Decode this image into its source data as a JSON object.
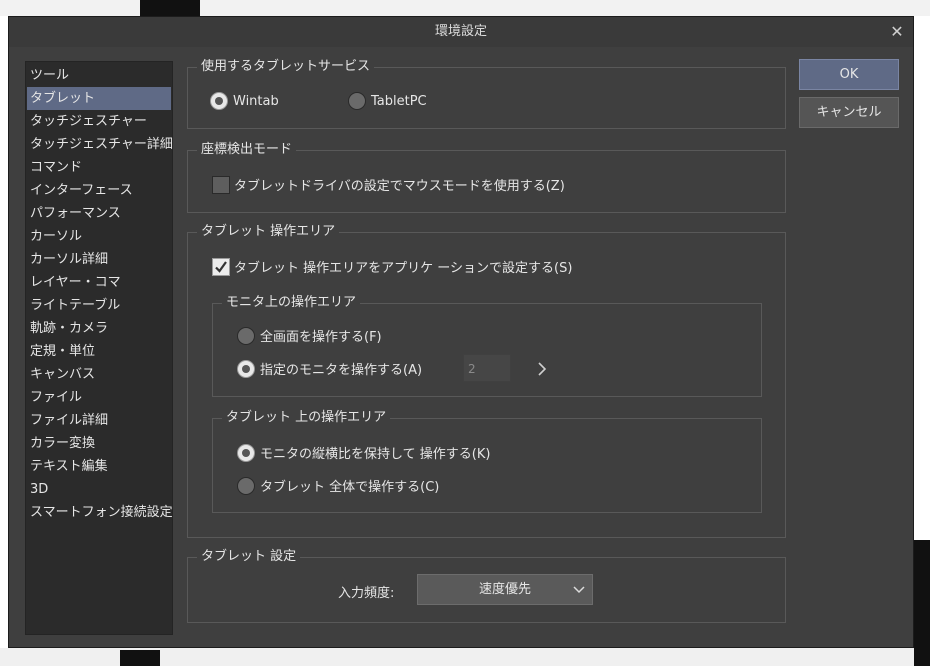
{
  "window": {
    "title": "環境設定"
  },
  "sidebar": {
    "items": [
      {
        "label": "ツール",
        "active": false
      },
      {
        "label": "タブレット",
        "active": true
      },
      {
        "label": "タッチジェスチャー",
        "active": false
      },
      {
        "label": "タッチジェスチャー詳細",
        "active": false
      },
      {
        "label": "コマンド",
        "active": false
      },
      {
        "label": "インターフェース",
        "active": false
      },
      {
        "label": "パフォーマンス",
        "active": false
      },
      {
        "label": "カーソル",
        "active": false
      },
      {
        "label": "カーソル詳細",
        "active": false
      },
      {
        "label": "レイヤー・コマ",
        "active": false
      },
      {
        "label": "ライトテーブル",
        "active": false
      },
      {
        "label": "軌跡・カメラ",
        "active": false
      },
      {
        "label": "定規・単位",
        "active": false
      },
      {
        "label": "キャンバス",
        "active": false
      },
      {
        "label": "ファイル",
        "active": false
      },
      {
        "label": "ファイル詳細",
        "active": false
      },
      {
        "label": "カラー変換",
        "active": false
      },
      {
        "label": "テキスト編集",
        "active": false
      },
      {
        "label": "3D",
        "active": false
      },
      {
        "label": "スマートフォン接続設定",
        "active": false
      }
    ]
  },
  "tablet_service": {
    "title": "使用するタブレットサービス",
    "wintab": "Wintab",
    "tabletpc": "TabletPC",
    "selected": "Wintab"
  },
  "coord_mode": {
    "title": "座標検出モード",
    "mouse_mode_label": "タブレットドライバの設定でマウスモードを使用する(Z)",
    "mouse_mode_checked": false
  },
  "operation_area": {
    "title": "タブレット 操作エリア",
    "app_setting_label": "タブレット 操作エリアをアプリケ ーションで設定する(S)",
    "app_setting_checked": true,
    "monitor_area": {
      "title": "モニタ上の操作エリア",
      "full_screen": "全画面を操作する(F)",
      "specified_monitor": "指定のモニタを操作する(A)",
      "selected": "specified",
      "monitor_number": "2"
    },
    "tablet_area": {
      "title": "タブレット 上の操作エリア",
      "keep_ratio": "モニタの縦横比を保持して 操作する(K)",
      "whole_tablet": "タブレット 全体で操作する(C)",
      "selected": "keep_ratio"
    }
  },
  "tablet_settings": {
    "title": "タブレット 設定",
    "input_freq_label": "入力頻度:",
    "input_freq_value": "速度優先"
  },
  "buttons": {
    "ok": "OK",
    "cancel": "キャンセル"
  },
  "colors": {
    "accent": "#5f6a86",
    "window_bg": "#3f3f3f",
    "sidebar_bg": "#2b2b2b"
  }
}
